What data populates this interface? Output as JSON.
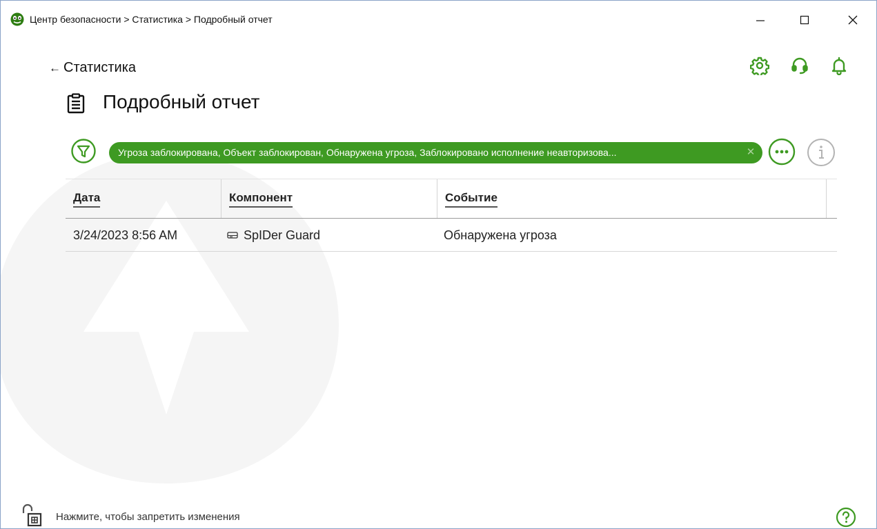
{
  "window": {
    "title": "Центр безопасности > Статистика > Подробный отчет",
    "controls": {
      "minimize": "minimize",
      "maximize": "maximize",
      "close": "close"
    }
  },
  "nav": {
    "back_label": "Статистика"
  },
  "header_icons": [
    "gear-icon",
    "headset-icon",
    "bell-icon"
  ],
  "page": {
    "title": "Подробный отчет",
    "icon": "clipboard-icon"
  },
  "filter": {
    "chip_text": "Угроза заблокирована, Объект заблокирован, Обнаружена угроза, Заблокировано исполнение неавторизова...",
    "clear_glyph": "✕"
  },
  "table": {
    "columns": [
      "Дата",
      "Компонент",
      "Событие"
    ],
    "rows": [
      {
        "date": "3/24/2023 8:56 AM",
        "component": "SpIDer Guard",
        "component_icon": "drive-icon",
        "event": "Обнаружена угроза"
      }
    ]
  },
  "footer": {
    "lock_text": "Нажмите, чтобы запретить изменения",
    "help_icon": "help-icon"
  },
  "colors": {
    "accent": "#3e9a22",
    "accent_dark": "#2c7d14",
    "text": "#1a1a1a",
    "muted": "#b3b3b3",
    "border": "#8aa3c7"
  }
}
